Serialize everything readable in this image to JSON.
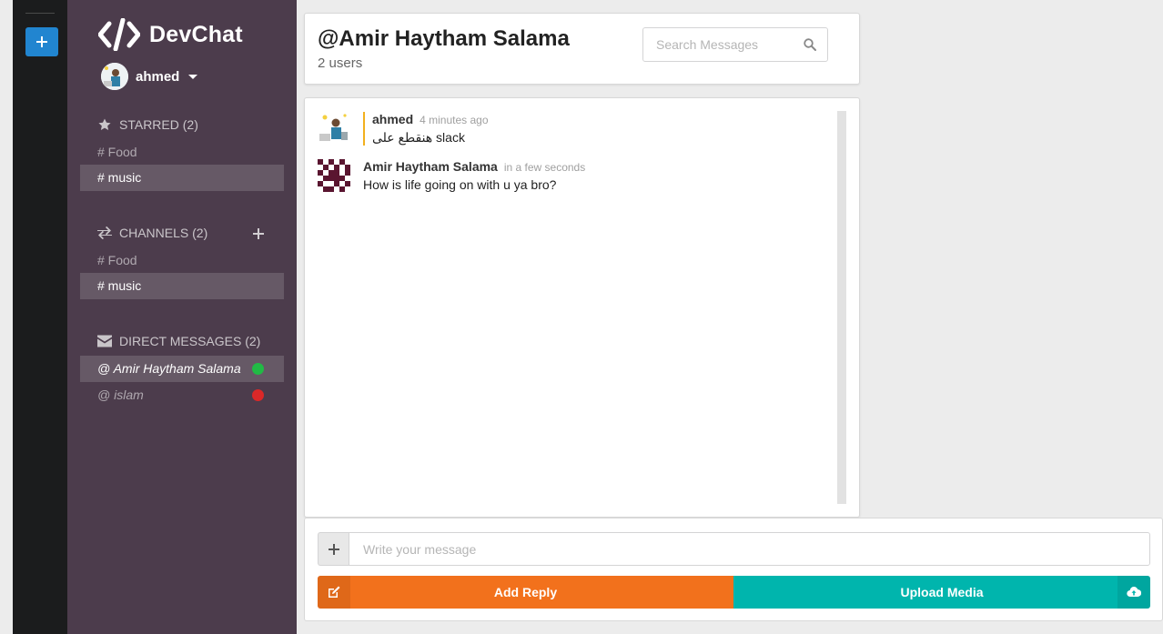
{
  "brand": {
    "name": "DevChat"
  },
  "user": {
    "name": "ahmed"
  },
  "sidebar": {
    "starred": {
      "label": "STARRED (2)",
      "items": [
        {
          "label": "# Food",
          "active": false
        },
        {
          "label": "# music",
          "active": true
        }
      ]
    },
    "channels": {
      "label": "CHANNELS (2)",
      "items": [
        {
          "label": "# Food",
          "active": false
        },
        {
          "label": "# music",
          "active": true
        }
      ]
    },
    "direct_messages": {
      "label": "DIRECT MESSAGES (2)",
      "items": [
        {
          "label": "@ Amir Haytham Salama",
          "status": "online",
          "status_color": "#21ba45",
          "active": true
        },
        {
          "label": "@ islam",
          "status": "offline",
          "status_color": "#db2828",
          "active": false
        }
      ]
    }
  },
  "header": {
    "title": "@Amir Haytham Salama",
    "subtitle": "2 users",
    "search_placeholder": "Search Messages"
  },
  "messages": [
    {
      "author": "ahmed",
      "time": "4 minutes ago",
      "text": "هنقطع على slack",
      "own": true
    },
    {
      "author": "Amir Haytham Salama",
      "time": "in a few seconds",
      "text": "How is life going on with u ya bro?",
      "own": false
    }
  ],
  "composer": {
    "placeholder": "Write your message",
    "reply_label": "Add Reply",
    "upload_label": "Upload Media"
  },
  "colors": {
    "rail": "#1b1c1d",
    "sidebar": "#4c3c4c",
    "reply": "#f2711c",
    "upload": "#00b5ad",
    "accent_blue": "#2185d0",
    "own_message_border": "#f2b01e"
  }
}
